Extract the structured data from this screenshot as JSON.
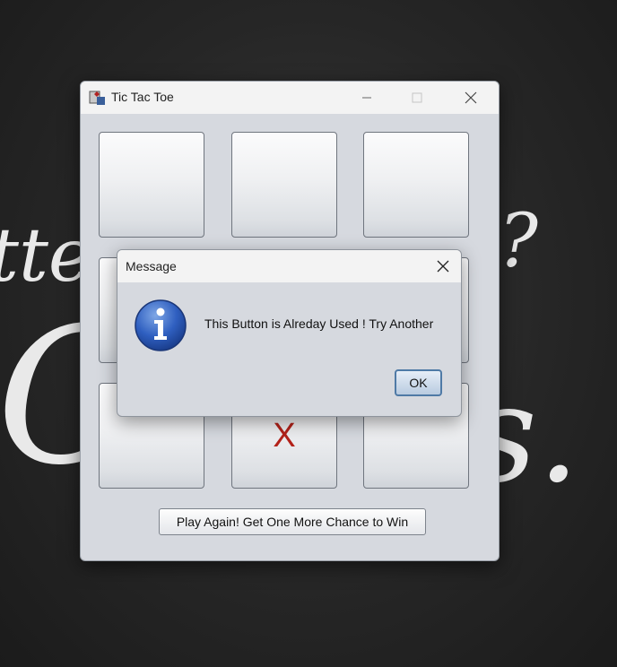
{
  "background": {
    "fragment_left_top": "tter",
    "fragment_right_top": "?",
    "fragment_left_large": "C",
    "fragment_right_large": "s."
  },
  "window": {
    "title": "Tic Tac Toe",
    "board": [
      "",
      "",
      "",
      "",
      "",
      "",
      "",
      "X",
      ""
    ],
    "play_again_label": "Play Again! Get One More Chance to Win",
    "mark_color": "#b3221a"
  },
  "dialog": {
    "title": "Message",
    "message": "This Button is Alreday Used ! Try Another",
    "ok_label": "OK",
    "icon": "info-icon"
  }
}
